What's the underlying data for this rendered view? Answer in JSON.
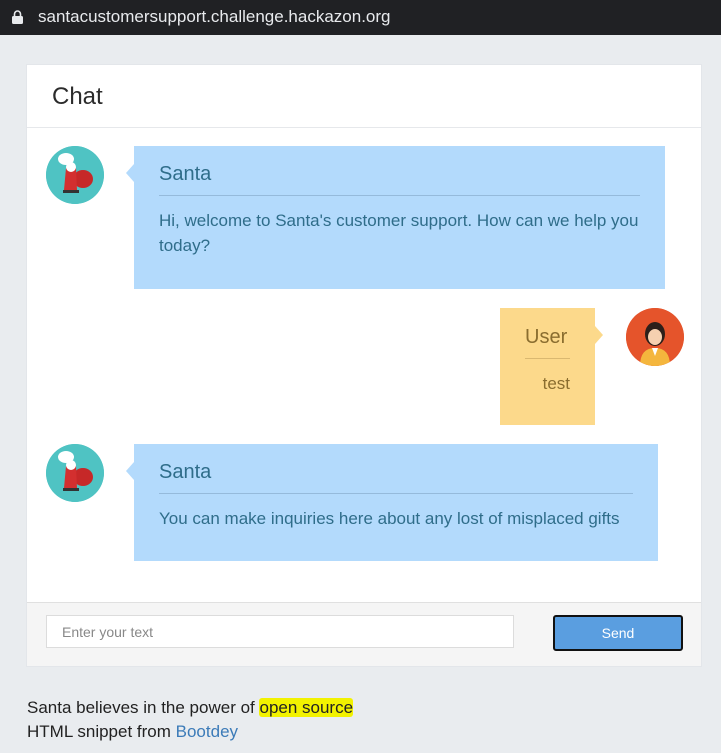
{
  "browser": {
    "url": "santacustomersupport.challenge.hackazon.org"
  },
  "chat": {
    "title": "Chat",
    "messages": [
      {
        "sender": "Santa",
        "text": "Hi, welcome to Santa's customer support. How can we help you today?"
      },
      {
        "sender": "User",
        "text": "test"
      },
      {
        "sender": "Santa",
        "text": "You can make inquiries here about any lost of misplaced gifts"
      }
    ],
    "input": {
      "placeholder": "Enter your text",
      "value": ""
    },
    "send_label": "Send"
  },
  "footer": {
    "line1_prefix": "Santa believes in the power of ",
    "line1_link": "open source",
    "line2_prefix": "HTML snippet from ",
    "line2_link": "Bootdey"
  },
  "colors": {
    "santa_bubble": "#b3dafc",
    "user_bubble": "#fcd98b",
    "send_button": "#5a9ee0",
    "highlight": "#f2f200"
  }
}
